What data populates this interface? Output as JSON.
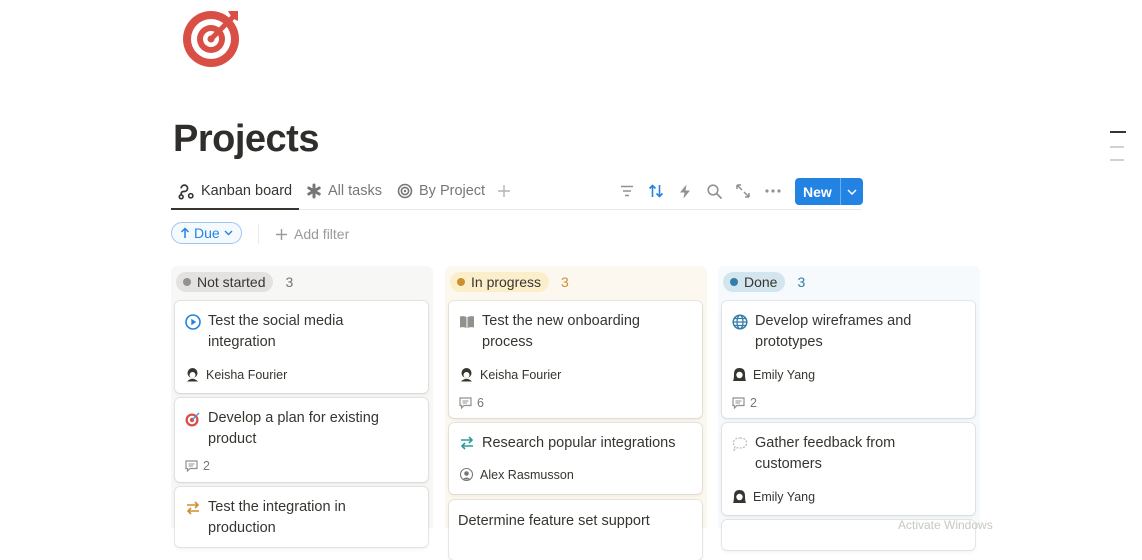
{
  "page": {
    "icon": "target-icon",
    "title": "Projects"
  },
  "tabs": [
    {
      "label": "Kanban board",
      "icon": "kanban-icon",
      "active": true
    },
    {
      "label": "All tasks",
      "icon": "asterisk-icon",
      "active": false
    },
    {
      "label": "By Project",
      "icon": "target-outline-icon",
      "active": false
    }
  ],
  "toolbar": {
    "tools": [
      "filter-icon",
      "sort-icon",
      "lightning-icon",
      "search-icon",
      "expand-icon",
      "more-icon"
    ],
    "new_label": "New",
    "accent": "#2383e2"
  },
  "filters": {
    "due_label": "Due",
    "add_filter_label": "Add filter"
  },
  "columns": [
    {
      "status": "Not started",
      "count": "3",
      "bg": "#f7f7f5",
      "pill_bg": "#e3e2e0",
      "dot": "#91918e",
      "count_color": "#787774",
      "cards": [
        {
          "title": "Test the social media integration",
          "icon": "play-circle-icon",
          "person": "Keisha Fourier",
          "comments": null
        },
        {
          "title": "Develop a plan for existing product",
          "icon": "dart-icon",
          "person": null,
          "comments": "2"
        },
        {
          "title": "Test the integration in production",
          "icon": "swap-arrows-icon",
          "person": null,
          "comments": null
        }
      ]
    },
    {
      "status": "In progress",
      "count": "3",
      "bg": "#fcf8ef",
      "pill_bg": "#fbeecb",
      "dot": "#cb912f",
      "count_color": "#cb912f",
      "cards": [
        {
          "title": "Test the new onboarding process",
          "icon": "book-icon",
          "person": "Keisha Fourier",
          "comments": "6"
        },
        {
          "title": "Research popular integrations",
          "icon": "swap-arrows-icon",
          "person": "Alex Rasmusson",
          "comments": null
        },
        {
          "title": "Determine feature set support",
          "icon": null,
          "person": null,
          "comments": null
        }
      ]
    },
    {
      "status": "Done",
      "count": "3",
      "bg": "#f6fafc",
      "pill_bg": "#d3e5ef",
      "dot": "#337ea9",
      "count_color": "#337ea9",
      "cards": [
        {
          "title": "Develop wireframes and prototypes",
          "icon": "globe-icon",
          "person": "Emily Yang",
          "comments": "2"
        },
        {
          "title": "Gather feedback from customers",
          "icon": "speech-bubble-icon",
          "person": "Emily Yang",
          "comments": null
        }
      ]
    }
  ],
  "watermark": "Activate Windows"
}
